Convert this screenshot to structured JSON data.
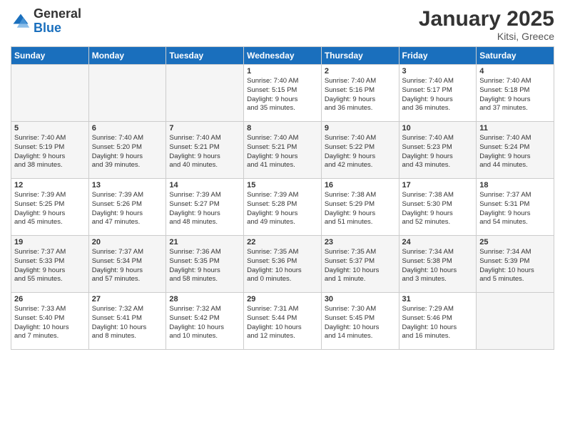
{
  "header": {
    "logo_general": "General",
    "logo_blue": "Blue",
    "title": "January 2025",
    "subtitle": "Kitsi, Greece"
  },
  "weekdays": [
    "Sunday",
    "Monday",
    "Tuesday",
    "Wednesday",
    "Thursday",
    "Friday",
    "Saturday"
  ],
  "weeks": [
    [
      {
        "day": "",
        "info": ""
      },
      {
        "day": "",
        "info": ""
      },
      {
        "day": "",
        "info": ""
      },
      {
        "day": "1",
        "info": "Sunrise: 7:40 AM\nSunset: 5:15 PM\nDaylight: 9 hours\nand 35 minutes."
      },
      {
        "day": "2",
        "info": "Sunrise: 7:40 AM\nSunset: 5:16 PM\nDaylight: 9 hours\nand 36 minutes."
      },
      {
        "day": "3",
        "info": "Sunrise: 7:40 AM\nSunset: 5:17 PM\nDaylight: 9 hours\nand 36 minutes."
      },
      {
        "day": "4",
        "info": "Sunrise: 7:40 AM\nSunset: 5:18 PM\nDaylight: 9 hours\nand 37 minutes."
      }
    ],
    [
      {
        "day": "5",
        "info": "Sunrise: 7:40 AM\nSunset: 5:19 PM\nDaylight: 9 hours\nand 38 minutes."
      },
      {
        "day": "6",
        "info": "Sunrise: 7:40 AM\nSunset: 5:20 PM\nDaylight: 9 hours\nand 39 minutes."
      },
      {
        "day": "7",
        "info": "Sunrise: 7:40 AM\nSunset: 5:21 PM\nDaylight: 9 hours\nand 40 minutes."
      },
      {
        "day": "8",
        "info": "Sunrise: 7:40 AM\nSunset: 5:21 PM\nDaylight: 9 hours\nand 41 minutes."
      },
      {
        "day": "9",
        "info": "Sunrise: 7:40 AM\nSunset: 5:22 PM\nDaylight: 9 hours\nand 42 minutes."
      },
      {
        "day": "10",
        "info": "Sunrise: 7:40 AM\nSunset: 5:23 PM\nDaylight: 9 hours\nand 43 minutes."
      },
      {
        "day": "11",
        "info": "Sunrise: 7:40 AM\nSunset: 5:24 PM\nDaylight: 9 hours\nand 44 minutes."
      }
    ],
    [
      {
        "day": "12",
        "info": "Sunrise: 7:39 AM\nSunset: 5:25 PM\nDaylight: 9 hours\nand 45 minutes."
      },
      {
        "day": "13",
        "info": "Sunrise: 7:39 AM\nSunset: 5:26 PM\nDaylight: 9 hours\nand 47 minutes."
      },
      {
        "day": "14",
        "info": "Sunrise: 7:39 AM\nSunset: 5:27 PM\nDaylight: 9 hours\nand 48 minutes."
      },
      {
        "day": "15",
        "info": "Sunrise: 7:39 AM\nSunset: 5:28 PM\nDaylight: 9 hours\nand 49 minutes."
      },
      {
        "day": "16",
        "info": "Sunrise: 7:38 AM\nSunset: 5:29 PM\nDaylight: 9 hours\nand 51 minutes."
      },
      {
        "day": "17",
        "info": "Sunrise: 7:38 AM\nSunset: 5:30 PM\nDaylight: 9 hours\nand 52 minutes."
      },
      {
        "day": "18",
        "info": "Sunrise: 7:37 AM\nSunset: 5:31 PM\nDaylight: 9 hours\nand 54 minutes."
      }
    ],
    [
      {
        "day": "19",
        "info": "Sunrise: 7:37 AM\nSunset: 5:33 PM\nDaylight: 9 hours\nand 55 minutes."
      },
      {
        "day": "20",
        "info": "Sunrise: 7:37 AM\nSunset: 5:34 PM\nDaylight: 9 hours\nand 57 minutes."
      },
      {
        "day": "21",
        "info": "Sunrise: 7:36 AM\nSunset: 5:35 PM\nDaylight: 9 hours\nand 58 minutes."
      },
      {
        "day": "22",
        "info": "Sunrise: 7:35 AM\nSunset: 5:36 PM\nDaylight: 10 hours\nand 0 minutes."
      },
      {
        "day": "23",
        "info": "Sunrise: 7:35 AM\nSunset: 5:37 PM\nDaylight: 10 hours\nand 1 minute."
      },
      {
        "day": "24",
        "info": "Sunrise: 7:34 AM\nSunset: 5:38 PM\nDaylight: 10 hours\nand 3 minutes."
      },
      {
        "day": "25",
        "info": "Sunrise: 7:34 AM\nSunset: 5:39 PM\nDaylight: 10 hours\nand 5 minutes."
      }
    ],
    [
      {
        "day": "26",
        "info": "Sunrise: 7:33 AM\nSunset: 5:40 PM\nDaylight: 10 hours\nand 7 minutes."
      },
      {
        "day": "27",
        "info": "Sunrise: 7:32 AM\nSunset: 5:41 PM\nDaylight: 10 hours\nand 8 minutes."
      },
      {
        "day": "28",
        "info": "Sunrise: 7:32 AM\nSunset: 5:42 PM\nDaylight: 10 hours\nand 10 minutes."
      },
      {
        "day": "29",
        "info": "Sunrise: 7:31 AM\nSunset: 5:44 PM\nDaylight: 10 hours\nand 12 minutes."
      },
      {
        "day": "30",
        "info": "Sunrise: 7:30 AM\nSunset: 5:45 PM\nDaylight: 10 hours\nand 14 minutes."
      },
      {
        "day": "31",
        "info": "Sunrise: 7:29 AM\nSunset: 5:46 PM\nDaylight: 10 hours\nand 16 minutes."
      },
      {
        "day": "",
        "info": ""
      }
    ]
  ]
}
